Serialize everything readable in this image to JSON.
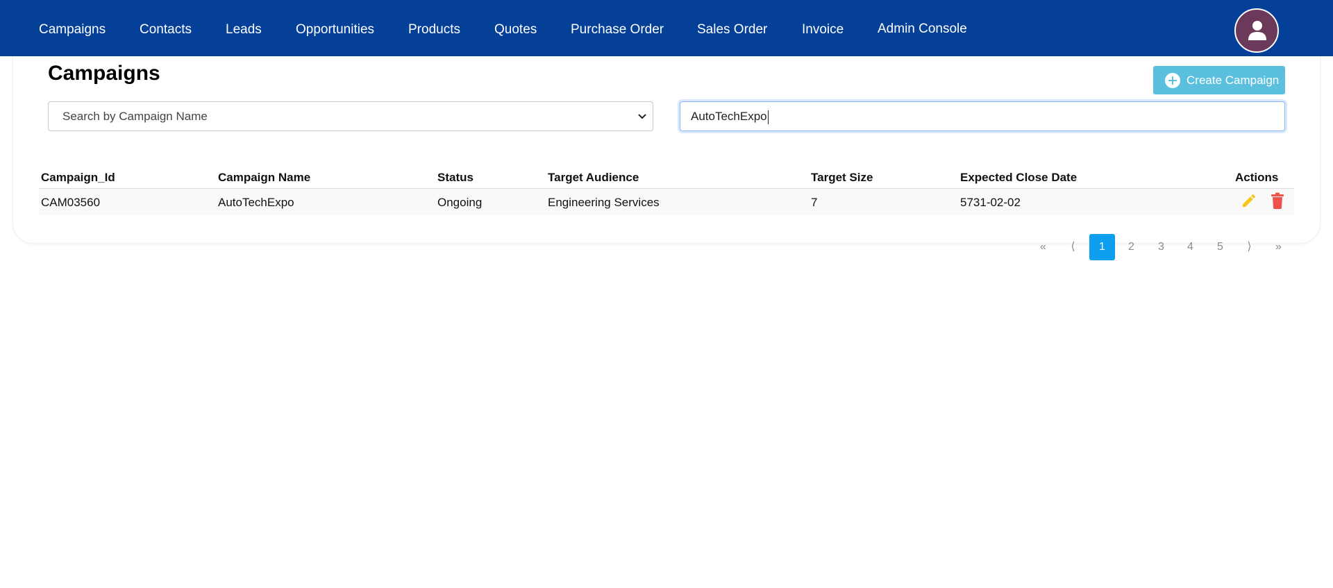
{
  "nav": {
    "items": [
      {
        "label": "Campaigns"
      },
      {
        "label": "Contacts"
      },
      {
        "label": "Leads"
      },
      {
        "label": "Opportunities"
      },
      {
        "label": "Products"
      },
      {
        "label": "Quotes"
      },
      {
        "label": "Purchase Order"
      },
      {
        "label": "Sales Order"
      },
      {
        "label": "Invoice"
      },
      {
        "label": "Admin Console"
      }
    ],
    "avatar_icon": "user-icon"
  },
  "page": {
    "title": "Campaigns",
    "create_button_label": "Create Campaign",
    "create_button_icon": "plus-circle-icon"
  },
  "filters": {
    "select_value": "Search by Campaign Name",
    "search_value": "AutoTechExpo"
  },
  "table": {
    "headers": [
      "Campaign_Id",
      "Campaign Name",
      "Status",
      "Target Audience",
      "Target Size",
      "Expected Close Date",
      "Actions"
    ],
    "rows": [
      {
        "campaign_id": "CAM03560",
        "campaign_name": "AutoTechExpo",
        "status": "Ongoing",
        "target_audience": "Engineering Services",
        "target_size": "7",
        "expected_close_date": "5731-02-02"
      }
    ],
    "action_icons": [
      "pencil-icon",
      "trash-icon"
    ]
  },
  "pagination": {
    "first": "«",
    "prev": "⟨",
    "pages": [
      "1",
      "2",
      "3",
      "4",
      "5"
    ],
    "current": "1",
    "next": "⟩",
    "last": "»"
  },
  "colors": {
    "navbar": "#043f98",
    "create_button": "#5bc0de",
    "active_page": "#0d9ef0",
    "edit_icon": "#f5c518",
    "delete_icon": "#f0504a",
    "avatar": "#6b3a5a"
  }
}
